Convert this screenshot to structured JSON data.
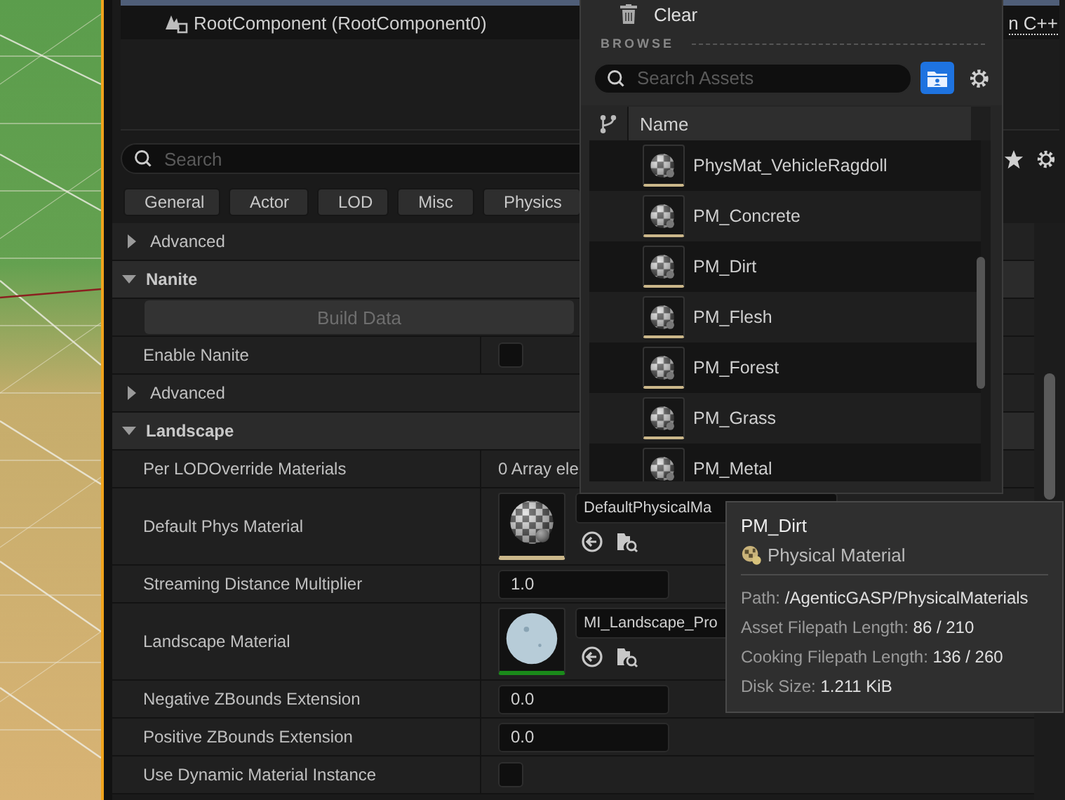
{
  "component_tree": {
    "items": [
      {
        "label": "RootComponent (RootComponent0)"
      }
    ],
    "link": "n C++"
  },
  "details": {
    "search": {
      "placeholder": "Search"
    },
    "filters": [
      "General",
      "Actor",
      "LOD",
      "Misc",
      "Physics"
    ],
    "rows": [
      {
        "kind": "advanced",
        "label": "Advanced",
        "expanded": false
      },
      {
        "kind": "category",
        "label": "Nanite",
        "expanded": true
      },
      {
        "kind": "button",
        "label": "Build Data",
        "disabled": true
      },
      {
        "kind": "checkbox",
        "label": "Enable Nanite",
        "checked": false
      },
      {
        "kind": "advanced",
        "label": "Advanced",
        "expanded": false
      },
      {
        "kind": "category",
        "label": "Landscape",
        "expanded": true
      },
      {
        "kind": "text",
        "label": "Per LODOverride Materials",
        "value": "0 Array ele"
      },
      {
        "kind": "physmaterial",
        "label": "Default Phys Material",
        "value": "DefaultPhysicalMa"
      },
      {
        "kind": "number",
        "label": "Streaming Distance Multiplier",
        "value": "1.0"
      },
      {
        "kind": "material",
        "label": "Landscape Material",
        "value": "MI_Landscape_Pro"
      },
      {
        "kind": "number",
        "label": "Negative ZBounds Extension",
        "value": "0.0"
      },
      {
        "kind": "number",
        "label": "Positive ZBounds Extension",
        "value": "0.0"
      },
      {
        "kind": "checkbox",
        "label": "Use Dynamic Material Instance",
        "checked": false
      }
    ]
  },
  "asset_picker": {
    "clear": "Clear",
    "section": "BROWSE",
    "search": {
      "placeholder": "Search Assets"
    },
    "column": "Name",
    "assets": [
      "PhysMat_VehicleRagdoll",
      "PM_Concrete",
      "PM_Dirt",
      "PM_Flesh",
      "PM_Forest",
      "PM_Grass",
      "PM_Metal"
    ]
  },
  "tooltip": {
    "title": "PM_Dirt",
    "type": "Physical Material",
    "fields": [
      {
        "label": "Path:",
        "value": "/AgenticGASP/PhysicalMaterials"
      },
      {
        "label": "Asset Filepath Length:",
        "value": "86 / 210"
      },
      {
        "label": "Cooking Filepath Length:",
        "value": "136 / 260"
      },
      {
        "label": "Disk Size:",
        "value": "1.211 KiB"
      }
    ]
  }
}
